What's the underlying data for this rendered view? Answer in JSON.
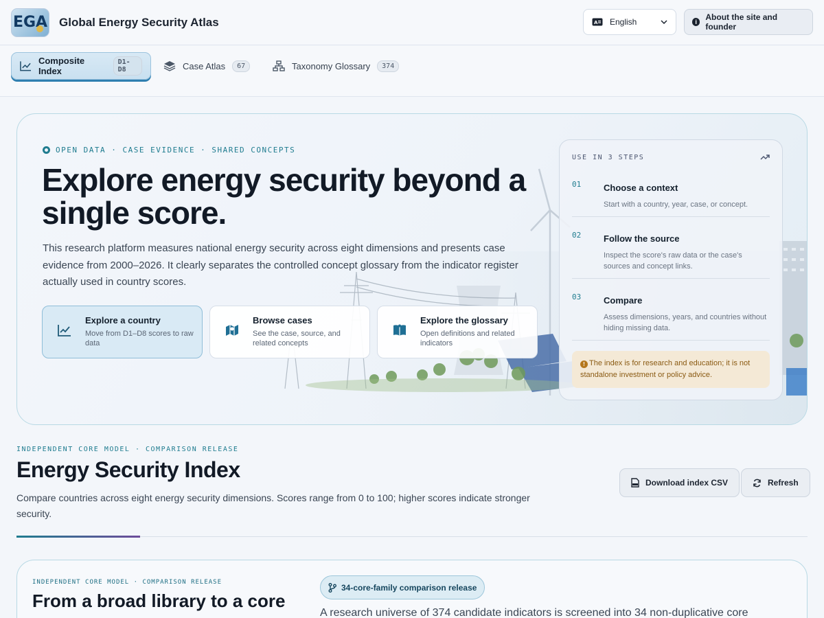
{
  "header": {
    "logo_text": "EGA",
    "site_title": "Global Energy Security Atlas",
    "language": "English",
    "about_label": "About the site and founder"
  },
  "tabs": [
    {
      "label": "Composite Index",
      "badge": "D1-D8",
      "icon": "line-chart-icon",
      "active": true
    },
    {
      "label": "Case Atlas",
      "badge": "67",
      "icon": "layers-icon",
      "active": false
    },
    {
      "label": "Taxonomy Glossary",
      "badge": "374",
      "icon": "hierarchy-icon",
      "active": false
    }
  ],
  "hero": {
    "eyebrow": "OPEN DATA · CASE EVIDENCE · SHARED CONCEPTS",
    "title": "Explore energy security beyond a single score.",
    "description": "This research platform measures national energy security across eight dimensions and presents case evidence from 2000–2026. It clearly separates the controlled concept glossary from the indicator register actually used in country scores.",
    "actions": [
      {
        "title": "Explore a country",
        "subtitle": "Move from D1–D8 scores to raw data",
        "icon": "line-chart-icon"
      },
      {
        "title": "Browse cases",
        "subtitle": "See the case, source, and related concepts",
        "icon": "map-icon"
      },
      {
        "title": "Explore the glossary",
        "subtitle": "Open definitions and related indicators",
        "icon": "book-icon"
      }
    ],
    "steps": {
      "heading": "USE IN 3 STEPS",
      "items": [
        {
          "num": "01",
          "title": "Choose a context",
          "desc": "Start with a country, year, case, or concept."
        },
        {
          "num": "02",
          "title": "Follow the source",
          "desc": "Inspect the score's raw data or the case's sources and concept links."
        },
        {
          "num": "03",
          "title": "Compare",
          "desc": "Assess dimensions, years, and countries without hiding missing data."
        }
      ],
      "notice": "The index is for research and education; it is not standalone investment or policy advice."
    }
  },
  "index": {
    "eyebrow": "INDEPENDENT CORE MODEL · COMPARISON RELEASE",
    "title": "Energy Security Index",
    "description": "Compare countries across eight energy security dimensions. Scores range from 0 to 100; higher scores indicate stronger security.",
    "download_label": "Download index CSV",
    "refresh_label": "Refresh"
  },
  "lower": {
    "eyebrow": "INDEPENDENT CORE MODEL · COMPARISON RELEASE",
    "title": "From a broad library to a core",
    "pill": "34-core-family comparison release",
    "description": "A research universe of 374 candidate indicators is screened into 34 non-duplicative core"
  },
  "colors": {
    "accent": "#1f7c8f",
    "active_tab_underline": "#2f7fb0",
    "warning_bg": "#f4e9d6",
    "warning_text": "#8a5a12"
  }
}
